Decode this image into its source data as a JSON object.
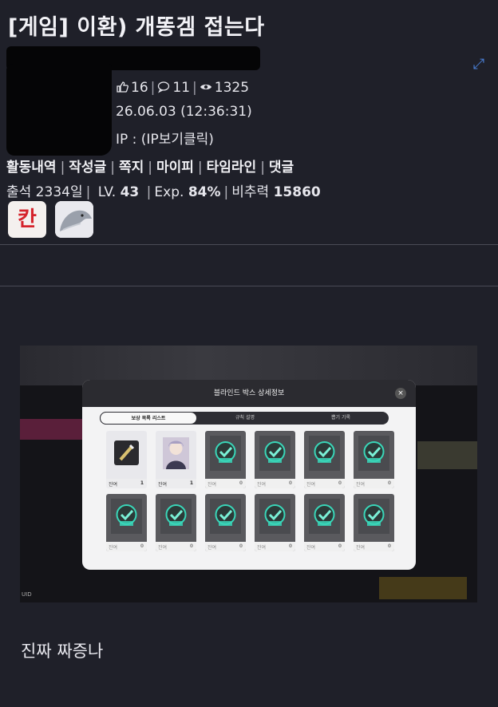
{
  "post": {
    "title": "[게임] 이환) 개똥겜 접는다",
    "likes": "16",
    "comments": "11",
    "views": "1325",
    "date": "26.06.03 (12:36:31)",
    "ip": "IP : (IP보기클릭)"
  },
  "profile_links": [
    "활동내역",
    "작성글",
    "쪽지",
    "마이피",
    "타임라인",
    "댓글"
  ],
  "stats": {
    "attend": "출석 2334일",
    "lv_label": "LV.",
    "lv": "43",
    "exp_label": "Exp.",
    "exp": "84%",
    "power_label": "비추력",
    "power": "15860"
  },
  "badges": {
    "hanja": "칸"
  },
  "screenshot": {
    "dialog_title": "블라인드 박스 상세정보",
    "close": "×",
    "tabs": [
      "보상 목록 리스트",
      "규칙 설명",
      "뽑기 기록"
    ],
    "cards": [
      {
        "kind": "item",
        "left": "잔여",
        "right": "1"
      },
      {
        "kind": "character",
        "left": "잔여",
        "right": "1"
      },
      {
        "kind": "done",
        "left": "잔여",
        "right": "0"
      },
      {
        "kind": "done",
        "left": "잔여",
        "right": "0"
      },
      {
        "kind": "done",
        "left": "잔여",
        "right": "0"
      },
      {
        "kind": "done",
        "left": "잔여",
        "right": "0"
      },
      {
        "kind": "done",
        "left": "잔여",
        "right": "0"
      },
      {
        "kind": "done",
        "left": "잔여",
        "right": "0"
      },
      {
        "kind": "done",
        "left": "잔여",
        "right": "0"
      },
      {
        "kind": "done",
        "left": "잔여",
        "right": "0"
      },
      {
        "kind": "done",
        "left": "잔여",
        "right": "0"
      },
      {
        "kind": "done",
        "left": "잔여",
        "right": "0"
      }
    ],
    "stamp": "완료",
    "corner": "UID"
  },
  "body_text": "진짜 짜증나",
  "colors": {
    "bg": "#1f2029",
    "accent": "#4a7fd6",
    "badge_red": "#d5232c"
  }
}
